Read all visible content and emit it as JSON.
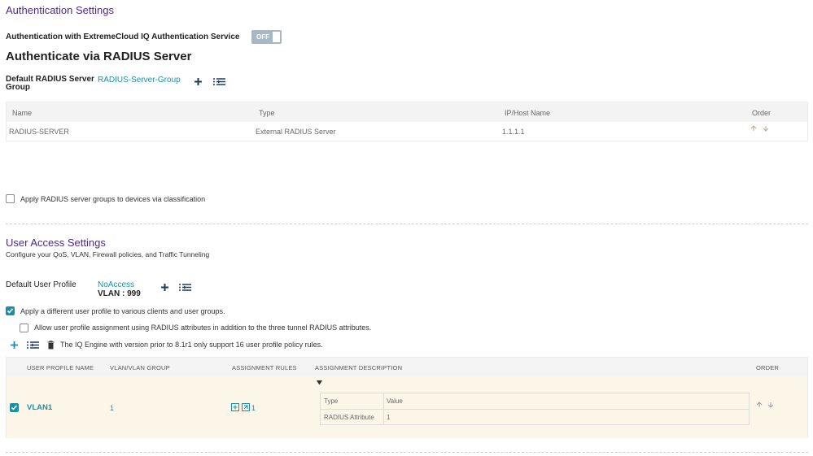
{
  "auth": {
    "section_title": "Authentication Settings",
    "extreme_label": "Authentication with ExtremeCloud IQ Authentication Service",
    "toggle_label": "OFF",
    "radius_title": "Authenticate via RADIUS Server",
    "default_group_label_line1": "Default RADIUS Server",
    "default_group_label_line2": "Group",
    "default_group_value": "RADIUS-Server-Group",
    "table": {
      "headers": [
        "Name",
        "Type",
        "IP/Host Name",
        "Order"
      ],
      "rows": [
        {
          "name": "RADIUS-SERVER",
          "type": "External RADIUS Server",
          "ip": "1.1.1.1"
        }
      ]
    },
    "classification_label": "Apply RADIUS server groups to devices via classification"
  },
  "user_access": {
    "section_title": "User Access Settings",
    "subtitle": "Configure your QoS, VLAN, Firewall policies, and Traffic Tunneling",
    "default_profile_label": "Default User Profile",
    "default_profile_value": "NoAccess",
    "default_profile_vlan": "VLAN : 999",
    "apply_diff_label": "Apply a different user profile to various clients and user groups.",
    "allow_radius_label": "Allow user profile assignment using RADIUS attributes in addition to the three tunnel RADIUS attributes.",
    "engine_note": "The IQ Engine with version prior to 8.1r1 only support 16 user profile policy rules.",
    "table": {
      "headers": [
        "USER PROFILE NAME",
        "VLAN/VLAN GROUP",
        "ASSIGNMENT RULES",
        "ASSIGNMENT DESCRIPTION",
        "ORDER"
      ],
      "row": {
        "name": "VLAN1",
        "vlan": "1",
        "rules_count": "1",
        "desc_headers": [
          "Type",
          "Value"
        ],
        "desc_type": "RADIUS Attribute",
        "desc_value": "1"
      }
    }
  },
  "colors": {
    "accent": "#1a8fa8",
    "title_purple": "#4b2a8c",
    "row_highlight": "#fcf6e8"
  }
}
